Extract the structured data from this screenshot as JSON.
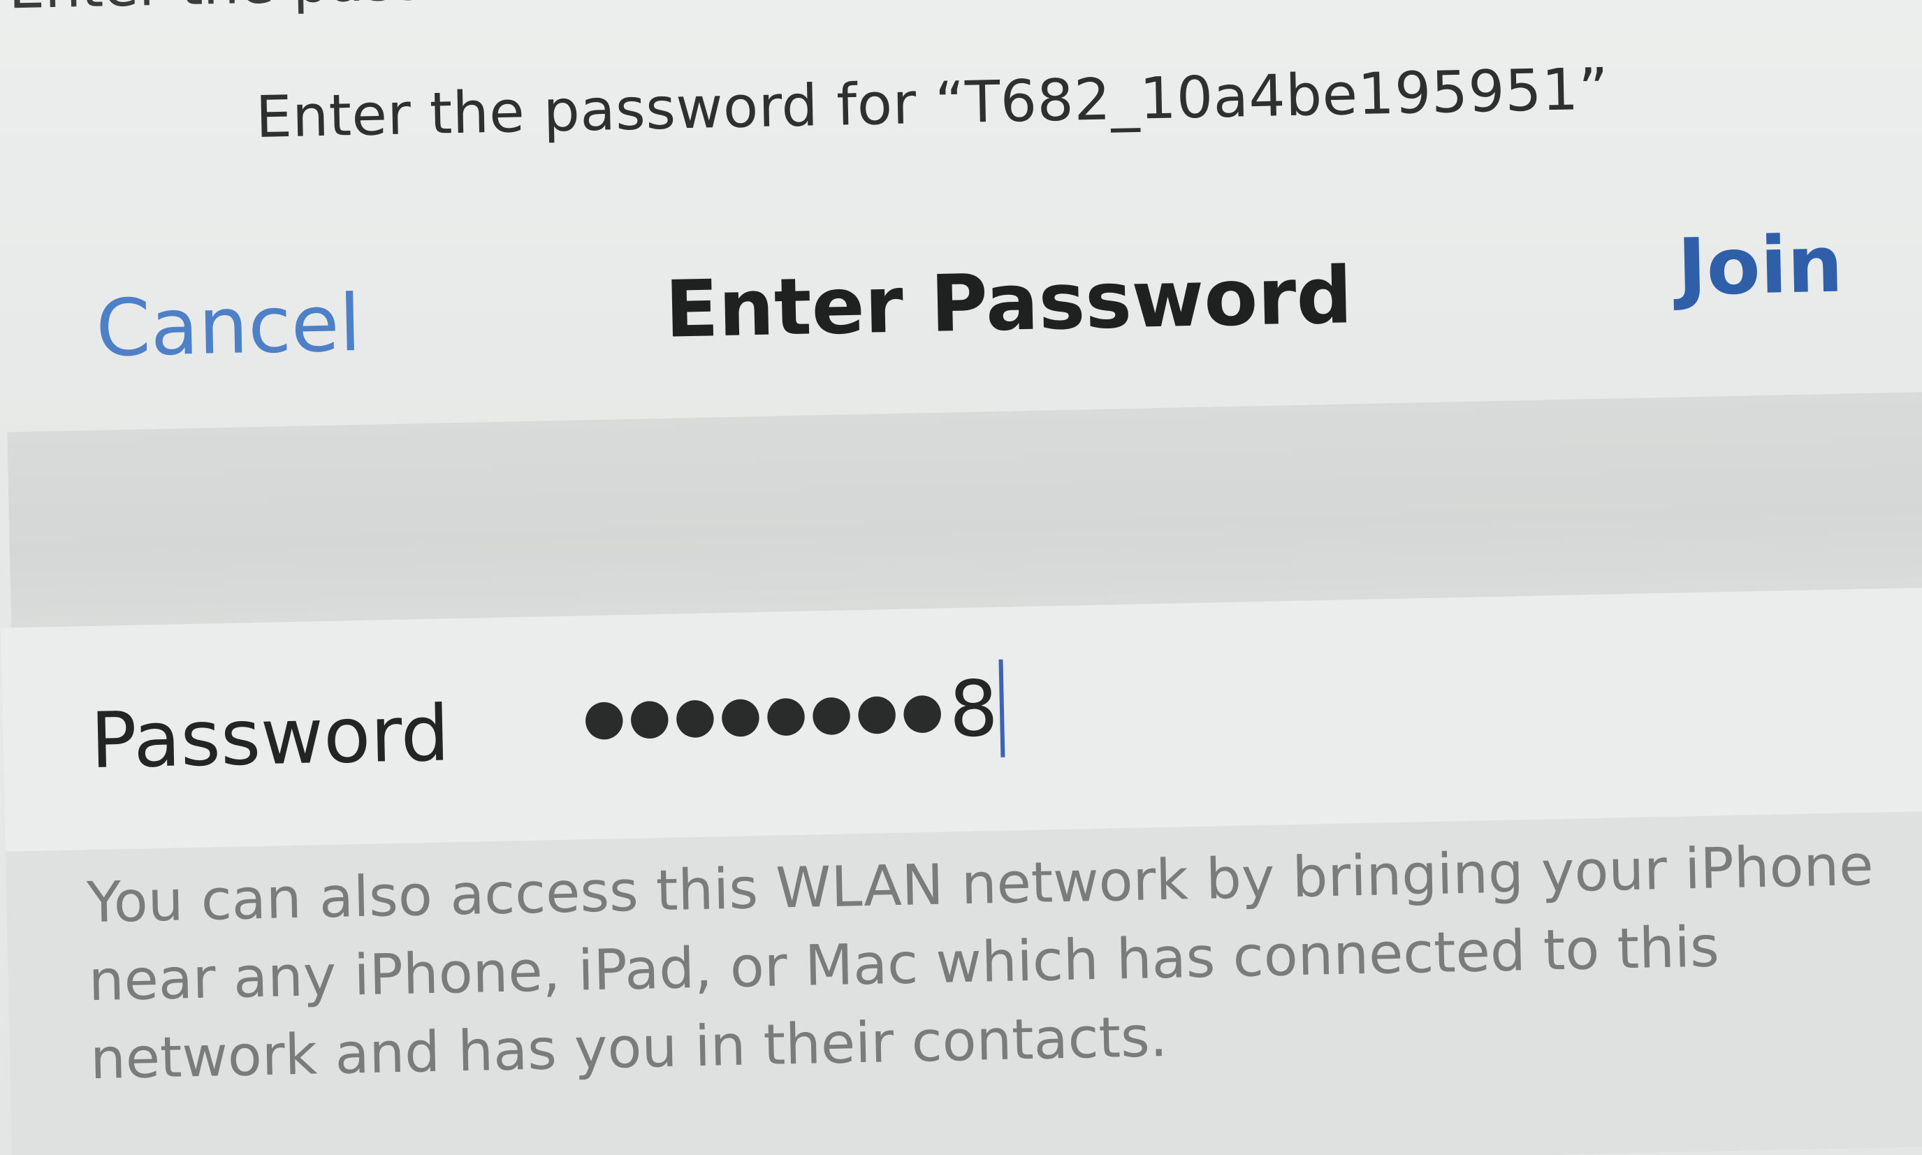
{
  "header": {
    "partial_text": "Enter the password for this network",
    "prompt_prefix": "Enter the password for “",
    "network_name": "T682_10a4be195951",
    "prompt_suffix": "”"
  },
  "navbar": {
    "cancel_label": "Cancel",
    "title": "Enter Password",
    "join_label": "Join"
  },
  "password_field": {
    "label": "Password",
    "masked_value": "●●●●●●●●",
    "last_char": "8"
  },
  "footer": {
    "info_text": "You can also access this WLAN network by bringing your iPhone near any iPhone, iPad, or Mac which has connected to this network and has you in their contacts."
  },
  "colors": {
    "accent": "#4d80c6",
    "join": "#2f5fa8",
    "caret": "#3d63b8"
  }
}
